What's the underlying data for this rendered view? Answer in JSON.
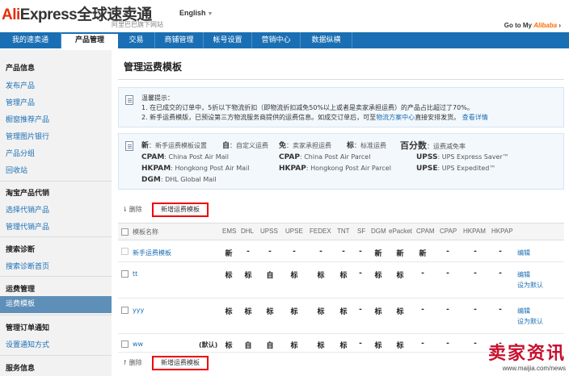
{
  "header": {
    "logo_red": "Ali",
    "logo_mid": "Express",
    "logo_cn": "全球速卖通",
    "logo_sub": "阿里巴巴旗下网站",
    "language": "English",
    "goto_prefix": "Go to My",
    "goto_brand": "Alibaba",
    "goto_suffix": "›"
  },
  "nav": {
    "tabs": [
      {
        "label": "我的速卖通"
      },
      {
        "label": "产品管理"
      },
      {
        "label": "交易"
      },
      {
        "label": "商铺管理"
      },
      {
        "label": "帐号设置"
      },
      {
        "label": "营销中心"
      },
      {
        "label": "数据纵横"
      }
    ]
  },
  "sidebar": {
    "sections": [
      {
        "title": "产品信息",
        "items": [
          "发布产品",
          "管理产品",
          "橱窗推荐产品",
          "管理图片银行",
          "产品分组",
          "回收站"
        ]
      },
      {
        "title": "淘宝产品代销",
        "items": [
          "选择代销产品",
          "管理代销产品"
        ]
      },
      {
        "title": "搜索诊断",
        "items": [
          "搜索诊断首页"
        ]
      },
      {
        "title": "运费管理",
        "items": [
          "运费模板"
        ]
      },
      {
        "title": "管理订单通知",
        "items": [
          "设置通知方式"
        ]
      },
      {
        "title": "服务信息",
        "items": []
      }
    ]
  },
  "main": {
    "title": "管理运费模板",
    "tip": {
      "heading": "温馨提示：",
      "line1": "1. 在已成交的订单中，5折以下物流折扣（即物流折扣减免50%以上或者是卖家承担运费）的产品占比超过了70%。",
      "line2_a": "2. 新手运费模版，已预设第三方物流服务商提供的运费信息。如成交订单后，可至",
      "line2_link": "物流方案中心",
      "line2_b": "直接安排发货。",
      "line2_more": "查看详情"
    },
    "legend": {
      "row1": [
        {
          "key": "新",
          "desc": "新手运费模板设置"
        },
        {
          "key": "自",
          "desc": "自定义运费"
        },
        {
          "key": "免",
          "desc": "卖家承担运费"
        },
        {
          "key": "标",
          "desc": "标准运费"
        },
        {
          "key": "百分数",
          "desc": "运费减免率"
        }
      ],
      "codes": [
        {
          "code": "CPAM",
          "desc": "China Post Air Mail"
        },
        {
          "code": "CPAP",
          "desc": "China Post Air Parcel"
        },
        {
          "code": "UPSS",
          "desc": "UPS Express Saver™"
        },
        {
          "code": "HKPAM",
          "desc": "Hongkong Post Air Mail"
        },
        {
          "code": "HKPAP",
          "desc": "Hongkong Post Air Parcel"
        },
        {
          "code": "UPSE",
          "desc": "UPS Expedited™"
        },
        {
          "code": "DGM",
          "desc": "DHL Global Mail"
        }
      ]
    },
    "toolbar": {
      "delete_label": "删除",
      "add_label": "新增运费模板"
    },
    "table": {
      "name_header": "模板名称",
      "columns": [
        "EMS",
        "DHL",
        "UPSS",
        "UPSE",
        "FEDEX",
        "TNT",
        "SF",
        "DGM",
        "ePacket",
        "CPAM",
        "CPAP",
        "HKPAM",
        "HKPAP"
      ],
      "rows": [
        {
          "name": "新手运费模板",
          "default": "",
          "cells": [
            "新",
            "-",
            "-",
            "-",
            "-",
            "-",
            "-",
            "新",
            "新",
            "新",
            "-",
            "-",
            "-"
          ],
          "actions": [
            "编辑"
          ]
        },
        {
          "name": "tt",
          "default": "",
          "cells": [
            "标",
            "标",
            "自",
            "标",
            "标",
            "标",
            "-",
            "标",
            "标",
            "-",
            "-",
            "-",
            "-"
          ],
          "actions": [
            "编辑",
            "设为默认"
          ]
        },
        {
          "name": "yyy",
          "default": "",
          "cells": [
            "标",
            "标",
            "标",
            "标",
            "标",
            "标",
            "-",
            "标",
            "标",
            "-",
            "-",
            "-",
            "-"
          ],
          "actions": [
            "编辑",
            "设为默认"
          ]
        },
        {
          "name": "ww",
          "default": "(默认)",
          "cells": [
            "标",
            "自",
            "自",
            "标",
            "标",
            "标",
            "-",
            "标",
            "标",
            "-",
            "-",
            "-",
            "-"
          ],
          "actions": []
        }
      ]
    }
  },
  "watermark": {
    "text": "卖家资讯",
    "url": "www.maijia.com/news"
  },
  "colors": {
    "nav": "#1a6fb4",
    "accent_red": "#e62e04",
    "link": "#1a6fb4",
    "active_side": "#5e8fb8"
  }
}
